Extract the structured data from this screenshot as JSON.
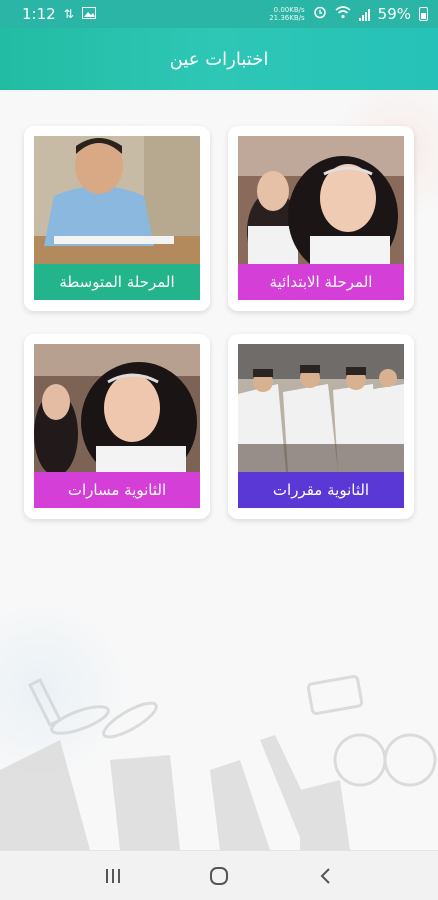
{
  "status_bar": {
    "time": "1:12",
    "speed_line1": "0.00KB/s",
    "speed_line2": "21.36KB/s",
    "battery": "59%",
    "icons": [
      "sync-icon",
      "image-icon",
      "alarm-icon",
      "wifi-icon",
      "signal-icon",
      "battery-icon"
    ]
  },
  "app_bar": {
    "title": "اختبارات عين"
  },
  "cards": [
    {
      "id": "primary",
      "label": "المرحلة الابتدائية",
      "color": "#d43fd7",
      "image": "girl-classroom-photo"
    },
    {
      "id": "intermediate",
      "label": "المرحلة المتوسطة",
      "color": "#23b48c",
      "image": "boy-desk-photo"
    },
    {
      "id": "secondary-courses",
      "label": "الثانوية مقررات",
      "color": "#5a38d6",
      "image": "students-lab-photo"
    },
    {
      "id": "secondary-tracks",
      "label": "الثانوية مسارات",
      "color": "#d43fd7",
      "image": "girl-classroom-photo"
    }
  ],
  "nav_bar": {
    "icons": [
      "recent-apps-icon",
      "home-icon",
      "back-icon"
    ]
  }
}
